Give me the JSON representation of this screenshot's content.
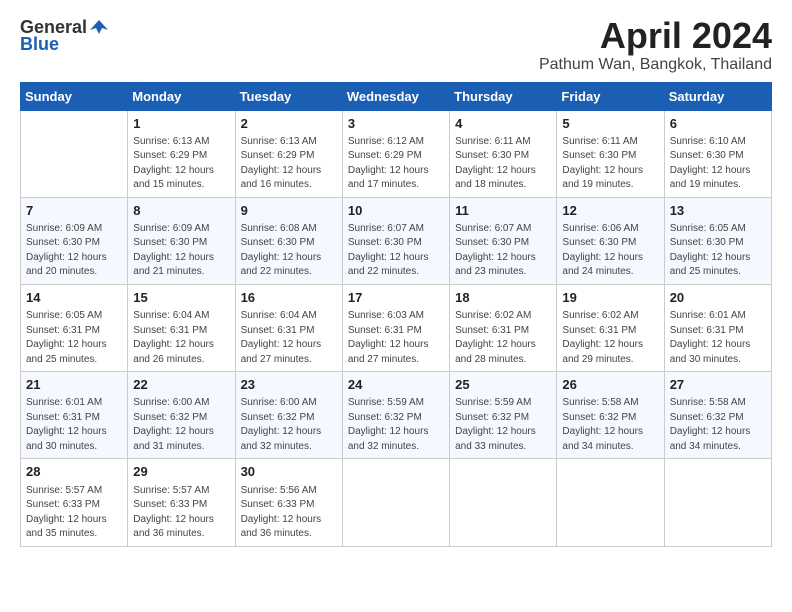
{
  "header": {
    "logo": {
      "text_general": "General",
      "text_blue": "Blue",
      "icon": "▶"
    },
    "title": "April 2024",
    "subtitle": "Pathum Wan, Bangkok, Thailand"
  },
  "weekdays": [
    "Sunday",
    "Monday",
    "Tuesday",
    "Wednesday",
    "Thursday",
    "Friday",
    "Saturday"
  ],
  "weeks": [
    [
      {
        "day": "",
        "info": ""
      },
      {
        "day": "1",
        "info": "Sunrise: 6:13 AM\nSunset: 6:29 PM\nDaylight: 12 hours\nand 15 minutes."
      },
      {
        "day": "2",
        "info": "Sunrise: 6:13 AM\nSunset: 6:29 PM\nDaylight: 12 hours\nand 16 minutes."
      },
      {
        "day": "3",
        "info": "Sunrise: 6:12 AM\nSunset: 6:29 PM\nDaylight: 12 hours\nand 17 minutes."
      },
      {
        "day": "4",
        "info": "Sunrise: 6:11 AM\nSunset: 6:30 PM\nDaylight: 12 hours\nand 18 minutes."
      },
      {
        "day": "5",
        "info": "Sunrise: 6:11 AM\nSunset: 6:30 PM\nDaylight: 12 hours\nand 19 minutes."
      },
      {
        "day": "6",
        "info": "Sunrise: 6:10 AM\nSunset: 6:30 PM\nDaylight: 12 hours\nand 19 minutes."
      }
    ],
    [
      {
        "day": "7",
        "info": "Sunrise: 6:09 AM\nSunset: 6:30 PM\nDaylight: 12 hours\nand 20 minutes."
      },
      {
        "day": "8",
        "info": "Sunrise: 6:09 AM\nSunset: 6:30 PM\nDaylight: 12 hours\nand 21 minutes."
      },
      {
        "day": "9",
        "info": "Sunrise: 6:08 AM\nSunset: 6:30 PM\nDaylight: 12 hours\nand 22 minutes."
      },
      {
        "day": "10",
        "info": "Sunrise: 6:07 AM\nSunset: 6:30 PM\nDaylight: 12 hours\nand 22 minutes."
      },
      {
        "day": "11",
        "info": "Sunrise: 6:07 AM\nSunset: 6:30 PM\nDaylight: 12 hours\nand 23 minutes."
      },
      {
        "day": "12",
        "info": "Sunrise: 6:06 AM\nSunset: 6:30 PM\nDaylight: 12 hours\nand 24 minutes."
      },
      {
        "day": "13",
        "info": "Sunrise: 6:05 AM\nSunset: 6:30 PM\nDaylight: 12 hours\nand 25 minutes."
      }
    ],
    [
      {
        "day": "14",
        "info": "Sunrise: 6:05 AM\nSunset: 6:31 PM\nDaylight: 12 hours\nand 25 minutes."
      },
      {
        "day": "15",
        "info": "Sunrise: 6:04 AM\nSunset: 6:31 PM\nDaylight: 12 hours\nand 26 minutes."
      },
      {
        "day": "16",
        "info": "Sunrise: 6:04 AM\nSunset: 6:31 PM\nDaylight: 12 hours\nand 27 minutes."
      },
      {
        "day": "17",
        "info": "Sunrise: 6:03 AM\nSunset: 6:31 PM\nDaylight: 12 hours\nand 27 minutes."
      },
      {
        "day": "18",
        "info": "Sunrise: 6:02 AM\nSunset: 6:31 PM\nDaylight: 12 hours\nand 28 minutes."
      },
      {
        "day": "19",
        "info": "Sunrise: 6:02 AM\nSunset: 6:31 PM\nDaylight: 12 hours\nand 29 minutes."
      },
      {
        "day": "20",
        "info": "Sunrise: 6:01 AM\nSunset: 6:31 PM\nDaylight: 12 hours\nand 30 minutes."
      }
    ],
    [
      {
        "day": "21",
        "info": "Sunrise: 6:01 AM\nSunset: 6:31 PM\nDaylight: 12 hours\nand 30 minutes."
      },
      {
        "day": "22",
        "info": "Sunrise: 6:00 AM\nSunset: 6:32 PM\nDaylight: 12 hours\nand 31 minutes."
      },
      {
        "day": "23",
        "info": "Sunrise: 6:00 AM\nSunset: 6:32 PM\nDaylight: 12 hours\nand 32 minutes."
      },
      {
        "day": "24",
        "info": "Sunrise: 5:59 AM\nSunset: 6:32 PM\nDaylight: 12 hours\nand 32 minutes."
      },
      {
        "day": "25",
        "info": "Sunrise: 5:59 AM\nSunset: 6:32 PM\nDaylight: 12 hours\nand 33 minutes."
      },
      {
        "day": "26",
        "info": "Sunrise: 5:58 AM\nSunset: 6:32 PM\nDaylight: 12 hours\nand 34 minutes."
      },
      {
        "day": "27",
        "info": "Sunrise: 5:58 AM\nSunset: 6:32 PM\nDaylight: 12 hours\nand 34 minutes."
      }
    ],
    [
      {
        "day": "28",
        "info": "Sunrise: 5:57 AM\nSunset: 6:33 PM\nDaylight: 12 hours\nand 35 minutes."
      },
      {
        "day": "29",
        "info": "Sunrise: 5:57 AM\nSunset: 6:33 PM\nDaylight: 12 hours\nand 36 minutes."
      },
      {
        "day": "30",
        "info": "Sunrise: 5:56 AM\nSunset: 6:33 PM\nDaylight: 12 hours\nand 36 minutes."
      },
      {
        "day": "",
        "info": ""
      },
      {
        "day": "",
        "info": ""
      },
      {
        "day": "",
        "info": ""
      },
      {
        "day": "",
        "info": ""
      }
    ]
  ]
}
